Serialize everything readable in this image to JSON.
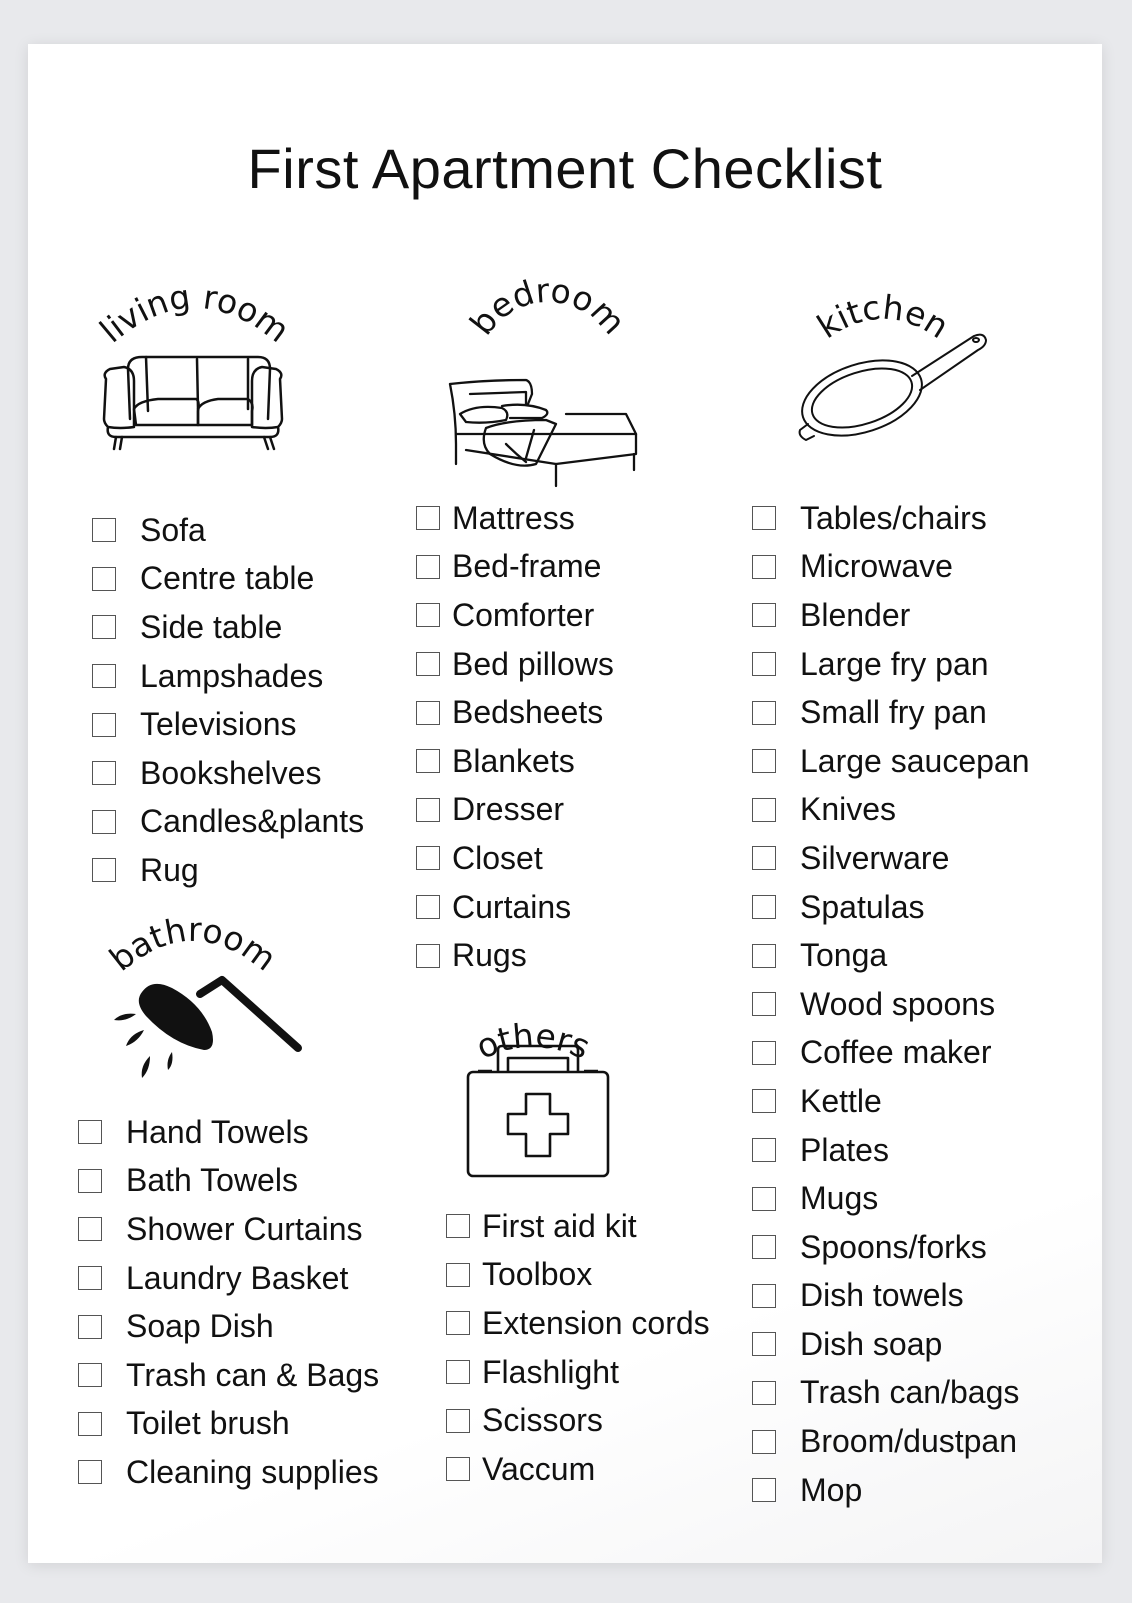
{
  "title": "First Apartment Checklist",
  "sections": {
    "living_room": {
      "label": "living room",
      "icon": "sofa-icon",
      "items": [
        "Sofa",
        "Centre table",
        "Side table",
        "Lampshades",
        "Televisions",
        "Bookshelves",
        "Candles&plants",
        "Rug"
      ]
    },
    "bedroom": {
      "label": "bedroom",
      "icon": "bed-icon",
      "items": [
        "Mattress",
        "Bed-frame",
        "Comforter",
        "Bed pillows",
        "Bedsheets",
        "Blankets",
        "Dresser",
        "Closet",
        "Curtains",
        "Rugs"
      ]
    },
    "kitchen": {
      "label": "kitchen",
      "icon": "frying-pan-icon",
      "items": [
        "Tables/chairs",
        "Microwave",
        "Blender",
        "Large fry pan",
        "Small fry pan",
        "Large saucepan",
        "Knives",
        "Silverware",
        "Spatulas",
        "Tonga",
        "Wood spoons",
        "Coffee maker",
        "Kettle",
        "Plates",
        "Mugs",
        "Spoons/forks",
        "Dish towels",
        "Dish soap",
        "Trash can/bags",
        "Broom/dustpan",
        "Mop"
      ]
    },
    "bathroom": {
      "label": "bathroom",
      "icon": "shower-head-icon",
      "items": [
        "Hand Towels",
        "Bath Towels",
        "Shower Curtains",
        "Laundry Basket",
        "Soap Dish",
        "Trash can & Bags",
        "Toilet brush",
        "Cleaning supplies"
      ]
    },
    "others": {
      "label": "others",
      "icon": "first-aid-kit-icon",
      "items": [
        "First aid kit",
        "Toolbox",
        "Extension cords",
        "Flashlight",
        "Scissors",
        "Vaccum"
      ]
    }
  }
}
